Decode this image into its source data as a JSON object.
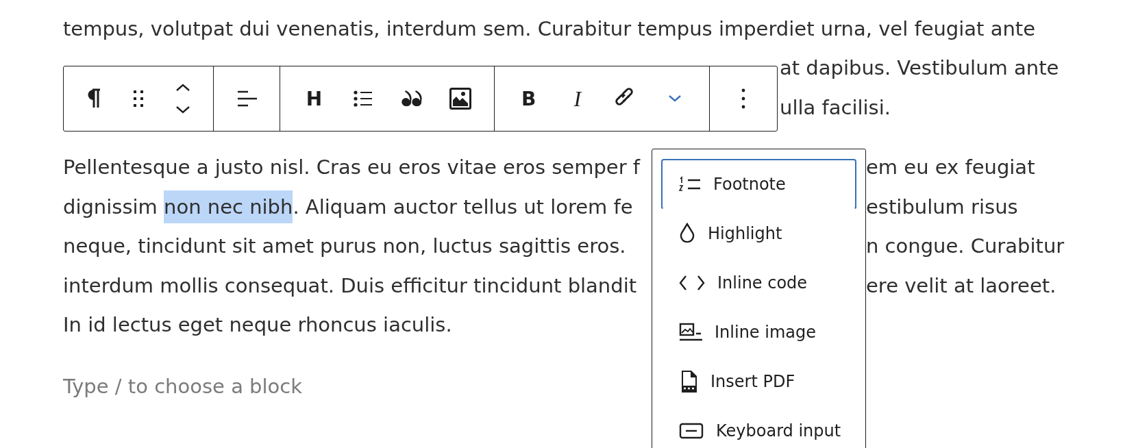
{
  "background_lines": [
    {
      "text": "tempus, volutpat dui venenatis, interdum sem. Curabitur tempus imperdiet urna, vel feugiat ante",
      "kind": "full"
    },
    {
      "text": "at dapibus. Vestibulum ante",
      "kind": "after-toolbar"
    },
    {
      "text": "ulla facilisi.",
      "kind": "after-toolbar"
    }
  ],
  "paragraph": {
    "lines": [
      {
        "left": [
          {
            "text": "Pellentesque a justo nisl. Cras eu eros vitae eros semper f",
            "selected": false
          }
        ],
        "right": "em eu ex feugiat"
      },
      {
        "left": [
          {
            "text": "dignissim ",
            "selected": false
          },
          {
            "text": "non nec nibh",
            "selected": true
          },
          {
            "text": ". Aliquam auctor tellus ut lorem fe",
            "selected": false
          }
        ],
        "right": "estibulum risus"
      },
      {
        "left": [
          {
            "text": "neque, tincidunt sit amet purus non, luctus sagittis eros.",
            "selected": false
          }
        ],
        "right": "n congue. Curabitur"
      },
      {
        "left": [
          {
            "text": "interdum mollis consequat. Duis efficitur tincidunt blandit",
            "selected": false
          }
        ],
        "right": "ere velit at laoreet."
      },
      {
        "left": [
          {
            "text": "In id lectus eget neque rhoncus iaculis.",
            "selected": false
          }
        ]
      }
    ]
  },
  "placeholder": "Type / to choose a block",
  "toolbar": {
    "groups": [
      {
        "items": [
          {
            "kind": "paragraph"
          },
          {
            "kind": "drag"
          },
          {
            "kind": "move"
          }
        ]
      },
      {
        "items": [
          {
            "kind": "align"
          }
        ]
      },
      {
        "items": [
          {
            "kind": "heading",
            "label": "H"
          },
          {
            "kind": "list"
          },
          {
            "kind": "quote"
          },
          {
            "kind": "image"
          }
        ]
      },
      {
        "items": [
          {
            "kind": "bold",
            "label": "B"
          },
          {
            "kind": "italic",
            "label": "I"
          },
          {
            "kind": "link"
          },
          {
            "kind": "more",
            "expanded": true
          }
        ]
      },
      {
        "items": [
          {
            "kind": "options"
          }
        ]
      }
    ]
  },
  "format_menu": {
    "items": [
      {
        "kind": "footnote",
        "label": "Footnote",
        "selected": true
      },
      {
        "kind": "highlight",
        "label": "Highlight",
        "selected": false
      },
      {
        "kind": "code",
        "label": "Inline code",
        "selected": false
      },
      {
        "kind": "image",
        "label": "Inline image",
        "selected": false
      },
      {
        "kind": "pdf",
        "label": "Insert PDF",
        "selected": false
      },
      {
        "kind": "keyboard",
        "label": "Keyboard input",
        "selected": false
      }
    ]
  }
}
